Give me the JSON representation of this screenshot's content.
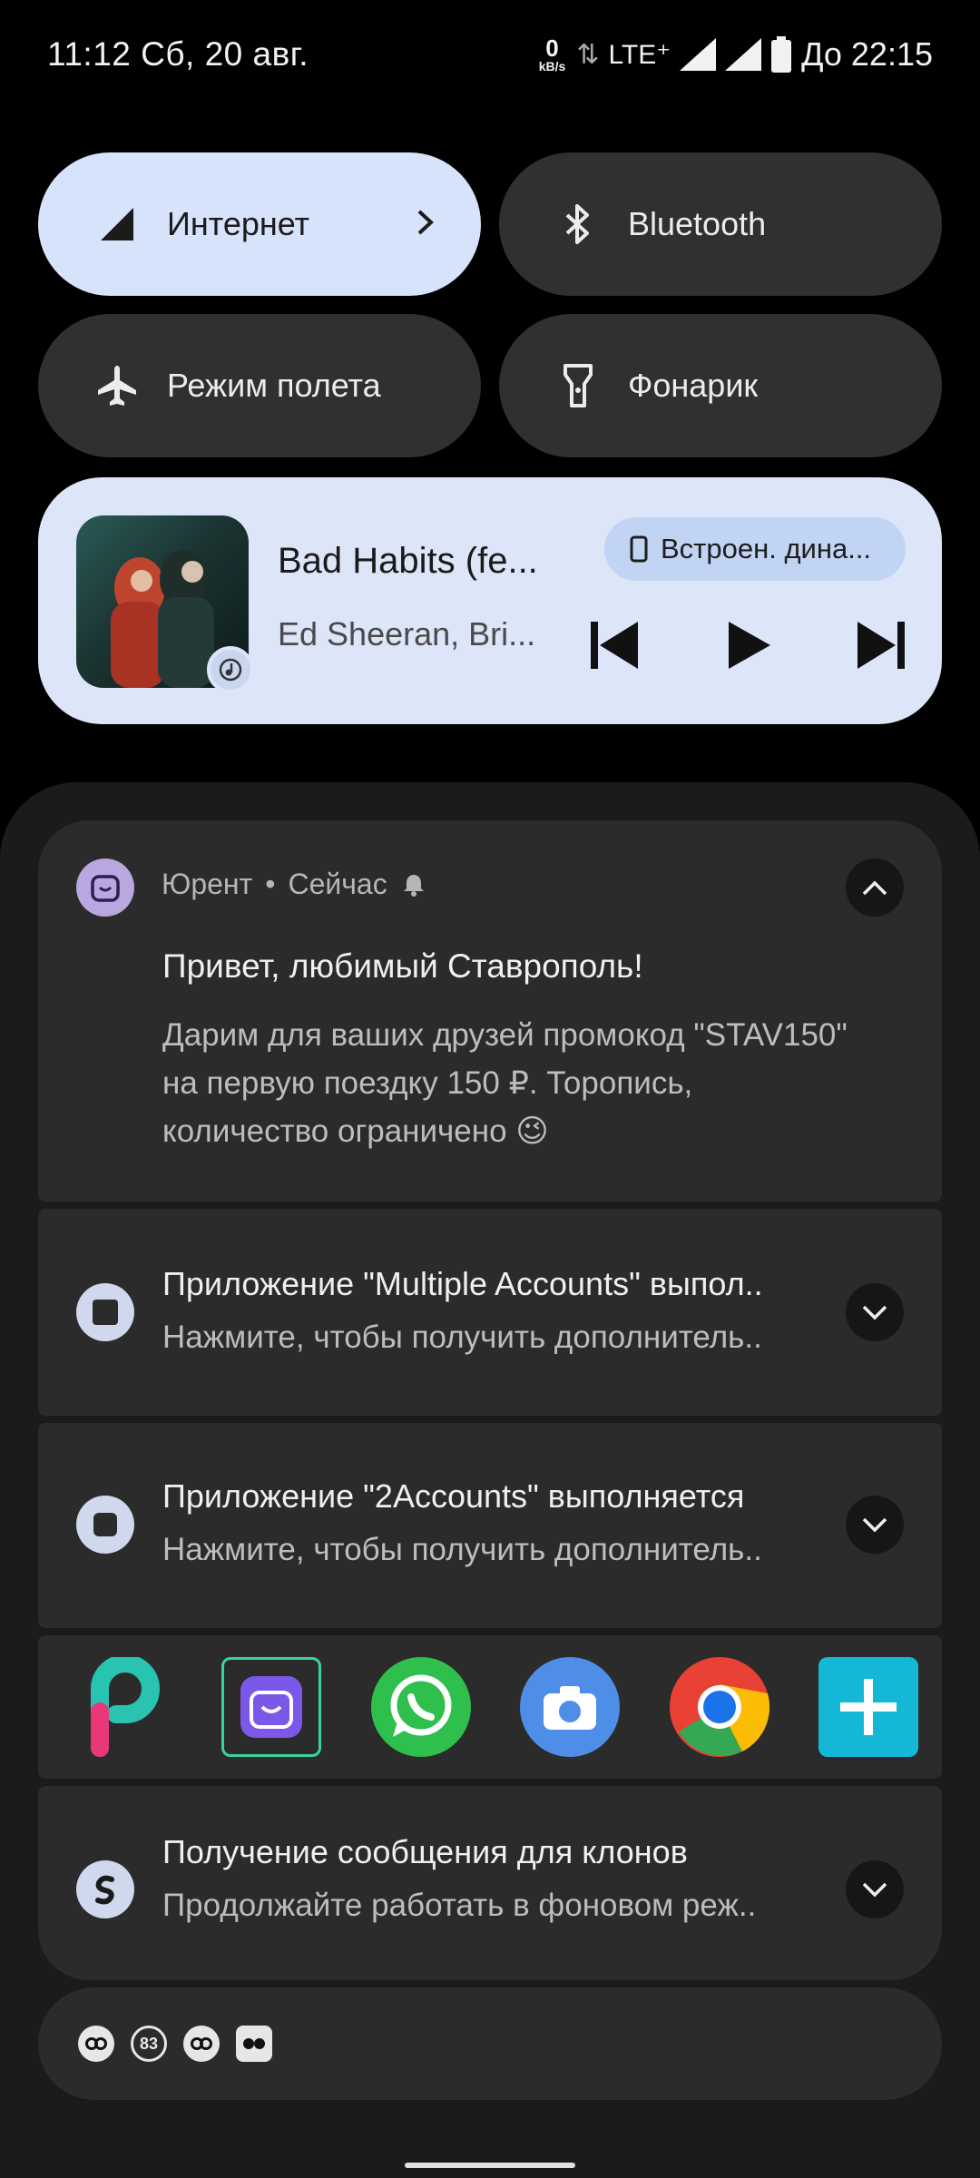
{
  "status_bar": {
    "time_date": "11:12 Сб, 20 авг.",
    "net_speed": "0",
    "net_unit": "kB/s",
    "network_type": "LTE⁺",
    "battery_text": "До 22:15"
  },
  "quick_tiles": [
    {
      "label": "Интернет",
      "icon": "signal-icon",
      "active": true
    },
    {
      "label": "Bluetooth",
      "icon": "bluetooth-icon",
      "active": false
    },
    {
      "label": "Режим полета",
      "icon": "airplane-icon",
      "active": false
    },
    {
      "label": "Фонарик",
      "icon": "flashlight-icon",
      "active": false
    }
  ],
  "media": {
    "title": "Bad Habits (fe...",
    "artist": "Ed Sheeran, Bri...",
    "output_device": "Встроен. дина..."
  },
  "notifications": {
    "urent": {
      "app": "Юрент",
      "time": "Сейчас",
      "title": "Привет, любимый Ставрополь!",
      "line1": "Дарим для ваших друзей промокод \"STAV150\"",
      "line2": "на первую поездку 150 ₽. Торопись,",
      "line3": "количество ограничено 😉"
    },
    "multiple_accounts": {
      "title": "Приложение \"Multiple Accounts\" выпол..",
      "text": "Нажмите, чтобы получить дополнитель.."
    },
    "two_accounts": {
      "title": "Приложение \"2Accounts\" выполняется",
      "text": "Нажмите, чтобы получить дополнитель.."
    },
    "clones": {
      "title": "Получение сообщения для клонов",
      "text": "Продолжайте работать в фоновом реж.."
    }
  },
  "app_shortcuts": [
    "picsart-icon",
    "urent-icon",
    "whatsapp-icon",
    "camera-icon",
    "chrome-icon",
    "add-clone-icon"
  ],
  "footer": {
    "badge_count": "83"
  },
  "colors": {
    "tile_active": "#d6e3fb",
    "tile_inactive": "#303030",
    "media_bg": "#dde6f9",
    "card_bg": "#2b2b2b",
    "shade_bg": "#1b1b1b"
  }
}
